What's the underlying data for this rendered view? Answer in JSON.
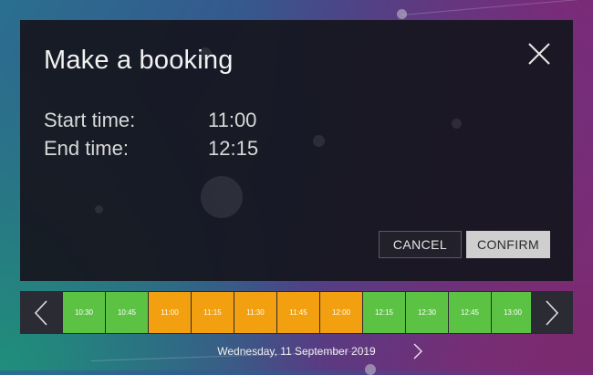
{
  "dialog": {
    "title": "Make a booking",
    "start_label": "Start time:",
    "start_value": "11:00",
    "end_label": "End time:",
    "end_value": "12:15",
    "close_icon": "close-icon",
    "cancel_label": "CANCEL",
    "confirm_label": "CONFIRM"
  },
  "timeline": {
    "prev_icon": "chevron-left-icon",
    "next_icon": "chevron-right-icon",
    "slots": [
      {
        "time": "10:30",
        "state": "free"
      },
      {
        "time": "10:45",
        "state": "free"
      },
      {
        "time": "11:00",
        "state": "selected"
      },
      {
        "time": "11:15",
        "state": "selected"
      },
      {
        "time": "11:30",
        "state": "selected"
      },
      {
        "time": "11:45",
        "state": "selected"
      },
      {
        "time": "12:00",
        "state": "selected"
      },
      {
        "time": "12:15",
        "state": "free"
      },
      {
        "time": "12:30",
        "state": "free"
      },
      {
        "time": "12:45",
        "state": "free"
      },
      {
        "time": "13:00",
        "state": "free"
      }
    ]
  },
  "date": {
    "label": "Wednesday, 11 September 2019",
    "next_icon": "chevron-right-icon"
  },
  "colors": {
    "free": "#5cc244",
    "selected": "#f2a00f",
    "confirm_bg": "#cfcfcf"
  }
}
